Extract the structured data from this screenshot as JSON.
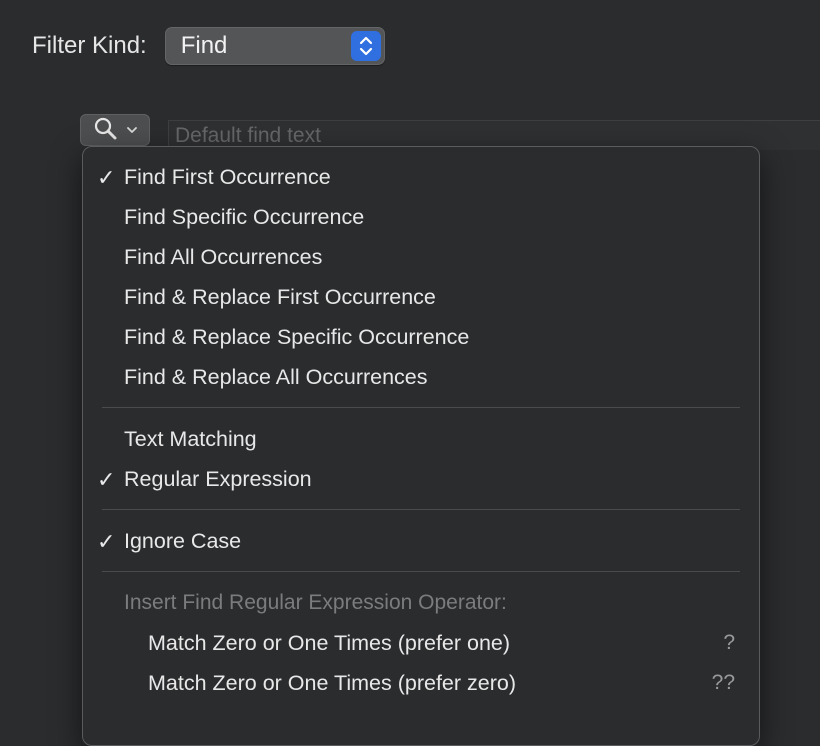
{
  "filter": {
    "label": "Filter Kind:",
    "value": "Find"
  },
  "search": {
    "placeholder": "Default find text"
  },
  "menu": {
    "group1": [
      {
        "label": "Find First Occurrence",
        "checked": "✓"
      },
      {
        "label": "Find Specific Occurrence",
        "checked": ""
      },
      {
        "label": "Find All Occurrences",
        "checked": ""
      },
      {
        "label": "Find & Replace First Occurrence",
        "checked": ""
      },
      {
        "label": "Find & Replace Specific Occurrence",
        "checked": ""
      },
      {
        "label": "Find & Replace All Occurrences",
        "checked": ""
      }
    ],
    "group2": [
      {
        "label": "Text Matching",
        "checked": ""
      },
      {
        "label": "Regular Expression",
        "checked": "✓"
      }
    ],
    "group3": [
      {
        "label": "Ignore Case",
        "checked": "✓"
      }
    ],
    "operator_header": "Insert Find Regular Expression Operator:",
    "operators": [
      {
        "label": "Match Zero or One Times (prefer one)",
        "shortcut": "?"
      },
      {
        "label": "Match Zero or One Times (prefer zero)",
        "shortcut": "??"
      }
    ]
  },
  "colors": {
    "background": "#2b2c2e",
    "accent": "#2f6fe0",
    "menu_bg": "#2a2c2e"
  },
  "icons": [
    "magnifying-glass-icon",
    "chevron-down-icon",
    "up-down-chevron-icon",
    "checkmark-icon"
  ]
}
